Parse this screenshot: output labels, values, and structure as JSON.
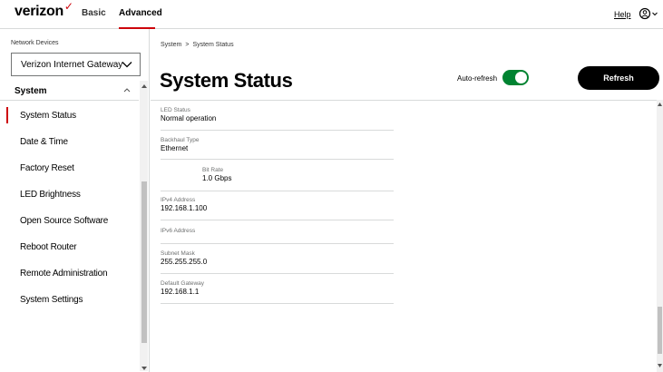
{
  "header": {
    "logo": "verizon",
    "nav": {
      "basic": "Basic",
      "advanced": "Advanced"
    },
    "help": "Help",
    "user_icon": "user-circle-icon"
  },
  "sidebar": {
    "network_devices_label": "Network Devices",
    "device_selected": "Verizon Internet Gateway",
    "section_title": "System",
    "items": [
      {
        "label": "System Status",
        "active": true
      },
      {
        "label": "Date & Time"
      },
      {
        "label": "Factory Reset"
      },
      {
        "label": "LED Brightness"
      },
      {
        "label": "Open Source Software"
      },
      {
        "label": "Reboot Router"
      },
      {
        "label": "Remote Administration"
      },
      {
        "label": "System Settings"
      }
    ]
  },
  "main": {
    "breadcrumb": {
      "root": "System",
      "separator": ">",
      "current": "System Status"
    },
    "title": "System Status",
    "auto_refresh_label": "Auto-refresh",
    "auto_refresh_on": true,
    "refresh_button": "Refresh",
    "fields": [
      {
        "label": "LED Status",
        "value": "Normal operation"
      },
      {
        "label": "Backhaul Type",
        "value": "Ethernet"
      },
      {
        "label": "Bit Rate",
        "value": "1.0 Gbps"
      },
      {
        "label": "IPv4 Address",
        "value": "192.168.1.100"
      },
      {
        "label": "IPv6 Address",
        "value": ""
      },
      {
        "label": "Subnet Mask",
        "value": "255.255.255.0"
      },
      {
        "label": "Default Gateway",
        "value": "192.168.1.1"
      }
    ]
  },
  "colors": {
    "accent_red": "#cd040b",
    "toggle_green": "#008331",
    "button_black": "#000000"
  }
}
